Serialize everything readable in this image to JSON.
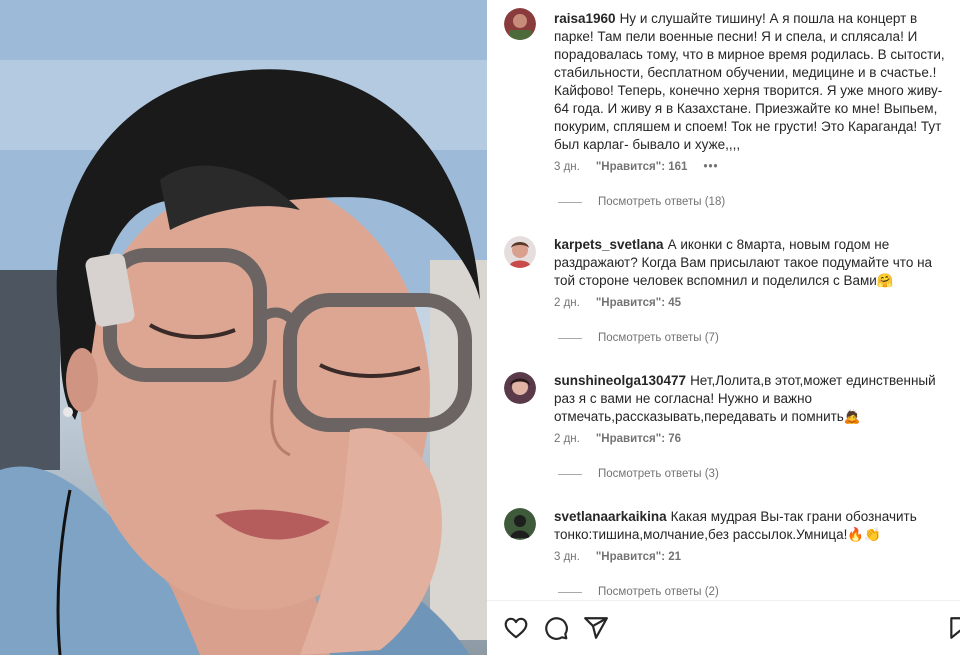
{
  "post": {
    "comments": [
      {
        "username": "raisa1960",
        "text": "Ну и слушайте тишину! А я пошла на концерт в парке! Там пели военные песни! Я и спела, и сплясала! И порадовалась тому, что в мирное время родилась. В сытости, стабильности, бесплатном обучении, медицине и в счастье.! Кайфово! Теперь, конечно херня творится. Я уже много живу- 64 года. И живу я в Казахстане. Приезжайте ко мне! Выпьем, покурим, спляшем и споем! Ток не грусти! Это Караганда! Тут был карлаг- бывало и хуже,,,,",
        "time": "3 дн.",
        "likes": "\"Нравится\": 161",
        "more": "•••",
        "replies": "Посмотреть ответы (18)",
        "avatar_color": "#8a3b3b"
      },
      {
        "username": "karpets_svetlana",
        "text": "А иконки с 8марта, новым годом не раздражают? Когда Вам присылают такое подумайте что на той стороне человек вспомнил и поделился с Вами🤗",
        "time": "2 дн.",
        "likes": "\"Нравится\": 45",
        "replies": "Посмотреть ответы (7)",
        "avatar_color": "#c94a4a"
      },
      {
        "username": "sunshineolga130477",
        "text": "Нет,Лолита,в этот,может единственный раз я с вами не согласна! Нужно и важно отмечать,рассказывать,передавать и помнить🙇",
        "time": "2 дн.",
        "likes": "\"Нравится\": 76",
        "replies": "Посмотреть ответы (3)",
        "avatar_color": "#5a3a4a"
      },
      {
        "username": "svetlanaarkaikina",
        "text": "Какая мудрая Вы-так грани обозначить тонко:тишина,молчание,без рассылок.Умница!🔥👏",
        "time": "3 дн.",
        "likes": "\"Нравится\": 21",
        "replies": "Посмотреть ответы (2)",
        "avatar_color": "#2c3a2c"
      }
    ]
  },
  "actions": {
    "like_icon": "heart-icon",
    "comment_icon": "comment-icon",
    "share_icon": "share-icon",
    "save_icon": "bookmark-icon"
  },
  "colors": {
    "text": "#262626",
    "secondary": "#737373",
    "divider": "#efefef"
  }
}
